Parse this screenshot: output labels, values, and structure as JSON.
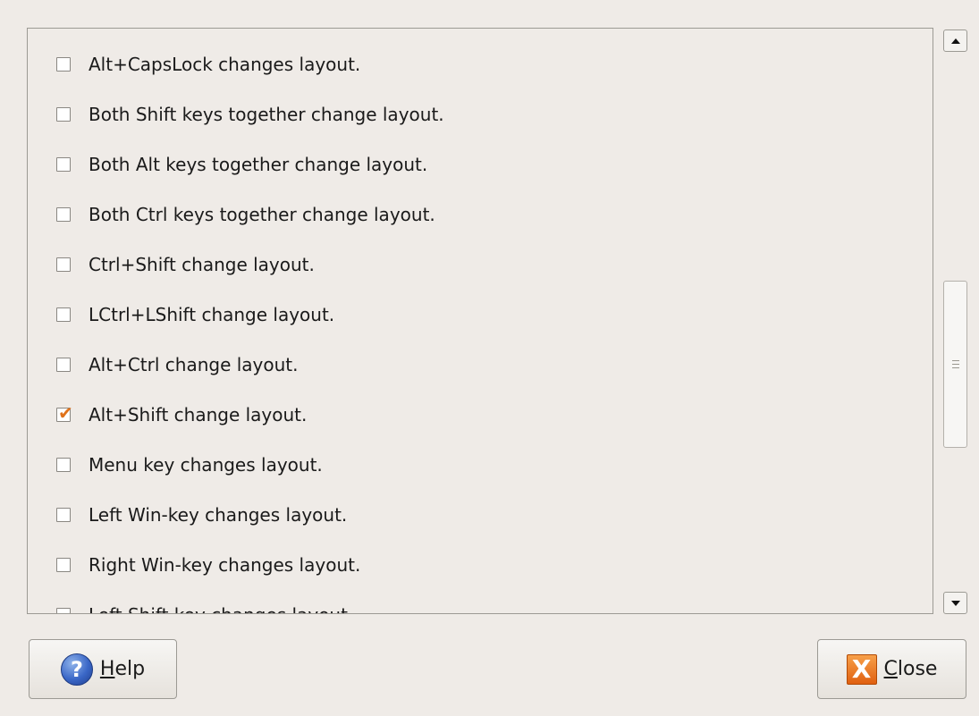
{
  "options": [
    {
      "label": "Alt+CapsLock changes layout.",
      "checked": false
    },
    {
      "label": "Both Shift keys together change layout.",
      "checked": false
    },
    {
      "label": "Both Alt keys together change layout.",
      "checked": false
    },
    {
      "label": "Both Ctrl keys together change layout.",
      "checked": false
    },
    {
      "label": "Ctrl+Shift change layout.",
      "checked": false
    },
    {
      "label": "LCtrl+LShift change layout.",
      "checked": false
    },
    {
      "label": "Alt+Ctrl change layout.",
      "checked": false
    },
    {
      "label": "Alt+Shift change layout.",
      "checked": true
    },
    {
      "label": "Menu key changes layout.",
      "checked": false
    },
    {
      "label": "Left Win-key changes layout.",
      "checked": false
    },
    {
      "label": "Right Win-key changes layout.",
      "checked": false
    },
    {
      "label": "Left Shift key changes layout.",
      "checked": false
    }
  ],
  "buttons": {
    "help": {
      "mnemonic": "H",
      "rest": "elp",
      "icon": "help-icon"
    },
    "close": {
      "mnemonic": "C",
      "rest": "lose",
      "icon": "close-icon"
    }
  },
  "icons": {
    "help_glyph": "?",
    "close_glyph": "X"
  },
  "colors": {
    "check_accent": "#e0721a",
    "background": "#efebe7"
  }
}
